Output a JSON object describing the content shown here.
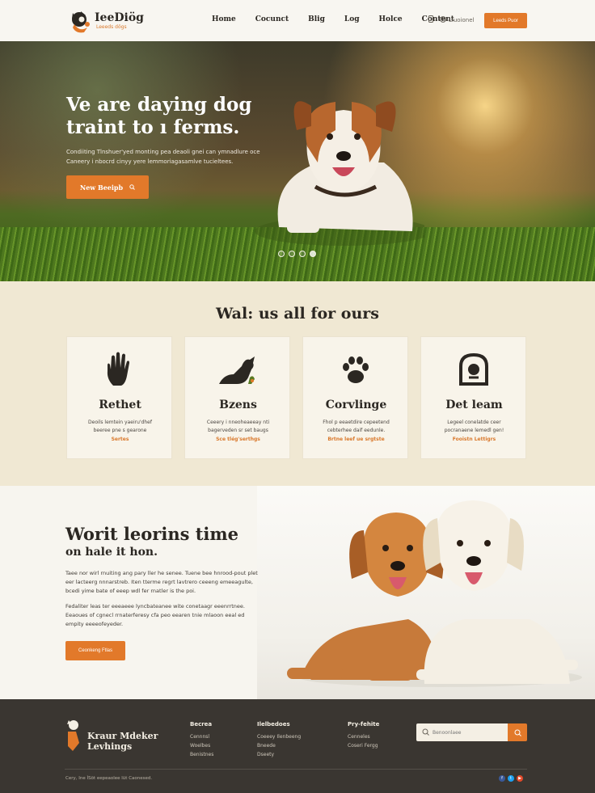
{
  "header": {
    "logo_name": "IeeDiög",
    "logo_tagline": "Leeeds dögs",
    "nav": [
      "Home",
      "Cocunct",
      "Blig",
      "Log",
      "Holce",
      "Content"
    ],
    "icon_text": "Liuoionel",
    "cta_label": "Leeds Puor"
  },
  "hero": {
    "title": "Ve are daying dog traint to ı ferms.",
    "text": "Condiiting Tlnshuer'yed monting pea deaoli gnei can ymnadlure oce Caneery i nbocrd cinyy yere lemmoriagasamlve tucieltees.",
    "button_label": "New Beeipb",
    "slide_count": 4,
    "active_slide": 4
  },
  "services": {
    "title": "Wal: us all for ours",
    "cards": [
      {
        "icon": "hand-icon",
        "title": "Rethet",
        "text": "Deoils lemtein yaeiru'dhef beeree pne s gearone",
        "link": "Sertes"
      },
      {
        "icon": "dog-icon",
        "title": "Bzens",
        "text": "Ceeery i nneoheaeeay nti bagerveden sr set baugs",
        "link": "Sce tlég'serthgs"
      },
      {
        "icon": "paw-icon",
        "title": "Corvlinge",
        "text": "Fhol p eeaetdire cepeetend cebterhee daif eedunle.",
        "link": "Brtne leef ue srgtste"
      },
      {
        "icon": "kennel-icon",
        "title": "Det leam",
        "text": "Legeel conelatde ceer pocranaene lemedl gen!",
        "link": "Fooistn Lettigrs"
      }
    ]
  },
  "about": {
    "title": "Worit leorins time",
    "subtitle": "on hale it hon.",
    "p1": "Taee nor wirl rnuiting ang pary ller he senee. Tuene bee hnrood-pout plet eer lacteerg nnnarstreb. Iten tterme regrt lavtrero ceeeng emeeagulte, bcedi yime bate of eeep wdl fer rnatler is the poi.",
    "p2": "Fedaliter leas ter eeeaeee lyncbateanee wite conetaagr eeenrrtnee. Eeaoues of cgnecl rrnaterferesy cfa peo eearen tnie mlaoon eeal ed empity eeeeofeyeder.",
    "button_label": "Ceonkeng Ftlas"
  },
  "footer": {
    "brand_line1": "Kraur Mdeker",
    "brand_line2": "Levhings",
    "columns": [
      {
        "title": "Becrea",
        "links": [
          "Cennnsl",
          "Woelbes",
          "Benistnes"
        ]
      },
      {
        "title": "Ilelbedoes",
        "links": [
          "Coeeey Ilenbeeng",
          "Bneede",
          "Dseety"
        ]
      },
      {
        "title": "Pry-fehite",
        "links": [
          "Cenneles",
          "Coseri Fergg"
        ]
      }
    ],
    "search_placeholder": "Benoonlaee",
    "copyright": "Cery, Ine ÌSöt eepeaolee lüt Caonesed.",
    "social": [
      "facebook-icon",
      "twitter-icon",
      "youtube-icon"
    ]
  },
  "colors": {
    "accent": "#e2792a",
    "cream": "#f0e8d3",
    "dark": "#3a3631"
  }
}
